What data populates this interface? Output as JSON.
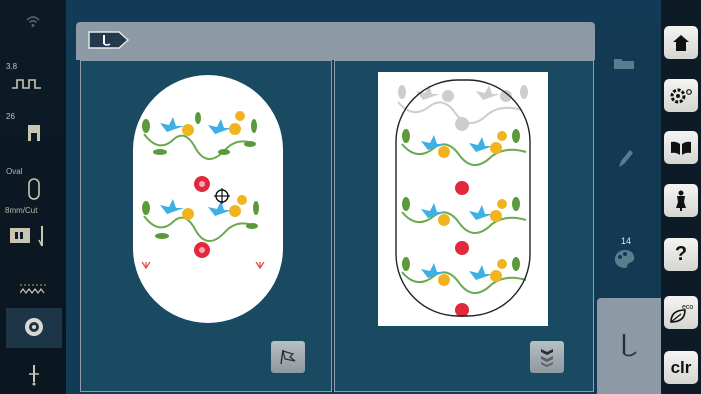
{
  "status_bar": {
    "needle_value": "3.8",
    "stitch_number": "26",
    "hoop_label": "Oval",
    "hoop_size": "8mm/Cut"
  },
  "right_menu": {
    "help_label": "?",
    "eco_label": "eco",
    "clear_label": "clr"
  },
  "side_tabs": {
    "color_count": "14"
  },
  "colors": {
    "background": "#123b55",
    "panel": "#1a4a62",
    "bar_grey": "#8c9aa6",
    "flower_red": "#e1293b",
    "flower_blue": "#3fb0e4",
    "flower_yellow": "#f2b41e",
    "leaf_green": "#5a9a3c"
  }
}
